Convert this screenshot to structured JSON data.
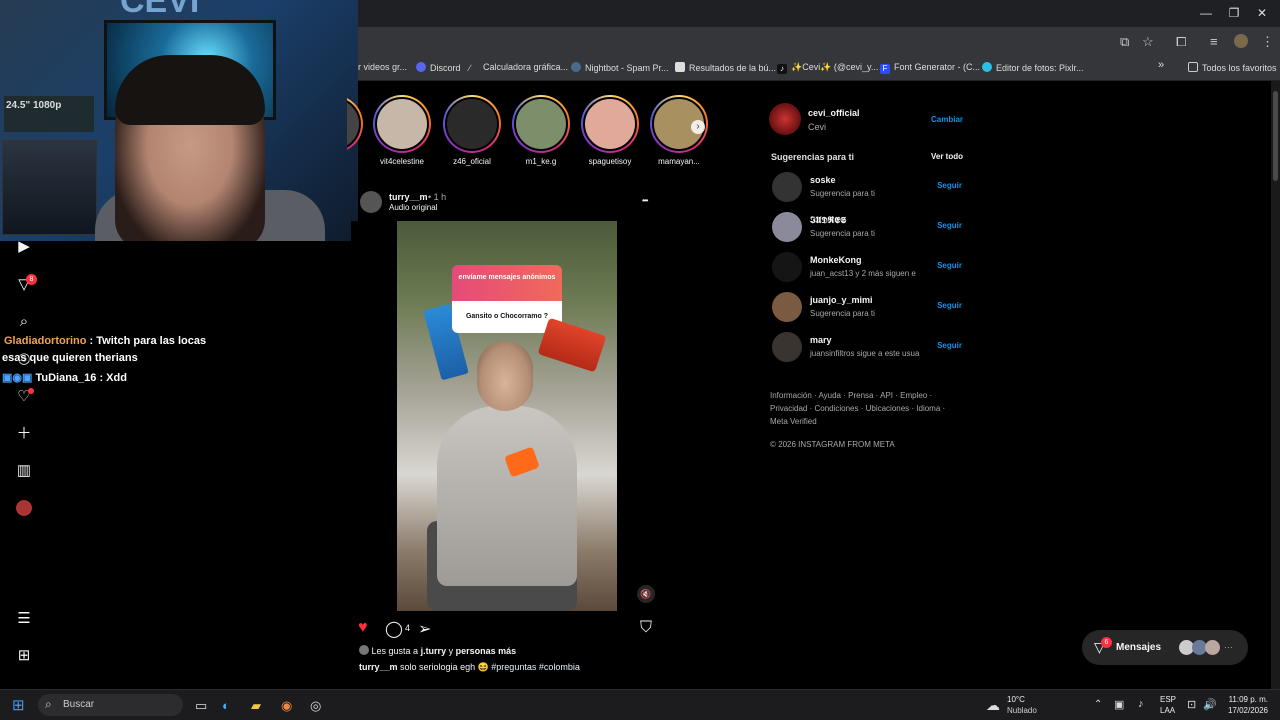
{
  "browser": {
    "bookmarks": [
      "r videos gr...",
      "Discord",
      "Calculadora gráfica...",
      "Nightbot - Spam Pr...",
      "Resultados de la bú...",
      "✨Cevi✨ (@cevi_y...",
      "Font Generator - (C...",
      "Editor de fotos: Pixlr...",
      "Todos los favoritos"
    ],
    "more_bookmarks": "»"
  },
  "nav": {
    "notifications_badge": "8"
  },
  "chat": {
    "line1_user": "Gladiadortorino",
    "line1_text": " : Twitch para las locas",
    "line2_text": "esas que quieren therians",
    "line3_user": "TuDiana_16",
    "line3_text": " : Xdd",
    "user1_color": "#f4a24a"
  },
  "stories": [
    {
      "name": "vit4celestine",
      "color": "#c7b7a8"
    },
    {
      "name": "z46_oficial",
      "color": "#2a2a2a"
    },
    {
      "name": "m1_ke.g",
      "color": "#7c8f6a"
    },
    {
      "name": "spaguetisoy",
      "color": "#e0a99a"
    },
    {
      "name": "mamayan...",
      "color": "#a89060"
    }
  ],
  "post": {
    "username": "turry__m",
    "time": " • 1 h",
    "audio": "Audio original",
    "more": "•••",
    "sticker_title": "envíame mensajes anónimos",
    "sticker_question": "Gansito o Chocorramo ?",
    "mute_icon": "🔇",
    "comment_count": "4",
    "likes_prefix": "Les gusta a ",
    "likes_user": "j.turry",
    "likes_mid": " y ",
    "likes_rest": "personas más",
    "caption_user": "turry__m",
    "caption_text": " solo seriologia egh 😆 ",
    "caption_tags": "#preguntas #colombia"
  },
  "sidebar": {
    "me_username": "cevi_official",
    "me_name": "Cevi",
    "switch": "Cambiar",
    "suggestions_title": "Sugerencias para ti",
    "see_all": "Ver todo",
    "suggestions": [
      {
        "user": "soske",
        "sub": "Sugerencia para ti",
        "action": "Seguir",
        "color": "#333"
      },
      {
        "user": "𝕴𝖀𝕯𝕽𝕰𝕾",
        "sub": "Sugerencia para ti",
        "action": "Seguir",
        "color": "#8a8a9a"
      },
      {
        "user": "MonkeKong",
        "sub": "juan_acst13 y 2 más siguen e",
        "action": "Seguir",
        "color": "#151515"
      },
      {
        "user": "juanjo_y_mimi",
        "sub": "Sugerencia para ti",
        "action": "Seguir",
        "color": "#7a5a40"
      },
      {
        "user": "mary",
        "sub": "juansinfiltros sigue a este usua",
        "action": "Seguir",
        "color": "#3a3430"
      }
    ],
    "footer_line1": "Información · Ayuda · Prensa · API · Empleo ·",
    "footer_line2": "Privacidad · Condiciones · Ubicaciones · Idioma ·",
    "footer_line3": "Meta Verified",
    "copyright": "© 2026 INSTAGRAM FROM META"
  },
  "messages": {
    "label": "Mensajes",
    "badge": "6",
    "more": "···"
  },
  "webcam": {
    "logo": "CEVI",
    "hud": "24.5\" 1080p"
  },
  "taskbar": {
    "search": "Buscar",
    "weather_temp": "10°C",
    "weather_desc": "Nublado",
    "lang1": "ESP",
    "lang2": "LAA",
    "time": "11:09 p. m.",
    "date": "17/02/2026"
  }
}
